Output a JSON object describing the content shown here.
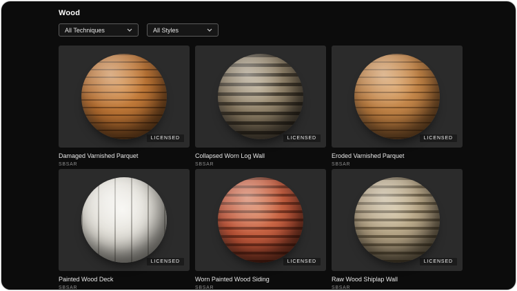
{
  "header": {
    "title": "Wood"
  },
  "filters": {
    "techniques": {
      "label": "All Techniques"
    },
    "styles": {
      "label": "All Styles"
    }
  },
  "cards": [
    {
      "title": "Damaged Varnished Parquet",
      "format": "SBSAR",
      "badge": "LICENSED",
      "sphere": {
        "highlight": "#d28a44",
        "mid": "#b06a2e",
        "shadow": "#5e3a1a",
        "stripe": "rgba(62,32,10,0.55)",
        "stripe_direction": "horizontal",
        "stripe_thickness": 2,
        "stripe_gap": 11
      }
    },
    {
      "title": "Collapsed Worn Log Wall",
      "format": "SBSAR",
      "badge": "LICENSED",
      "sphere": {
        "highlight": "#b5a78d",
        "mid": "#7d6f58",
        "shadow": "#3a332a",
        "stripe": "rgba(28,23,16,0.65)",
        "stripe_direction": "horizontal",
        "stripe_thickness": 5,
        "stripe_gap": 14
      }
    },
    {
      "title": "Eroded Varnished Parquet",
      "format": "SBSAR",
      "badge": "LICENSED",
      "sphere": {
        "highlight": "#d79a5a",
        "mid": "#b5773c",
        "shadow": "#5f3d1e",
        "stripe": "rgba(70,40,14,0.5)",
        "stripe_direction": "horizontal",
        "stripe_thickness": 2,
        "stripe_gap": 11
      }
    },
    {
      "title": "Painted Wood Deck",
      "format": "SBSAR",
      "badge": "LICENSED",
      "sphere": {
        "highlight": "#f6f5f1",
        "mid": "#dcd9d1",
        "shadow": "#8c8a81",
        "stripe": "rgba(95,92,84,0.45)",
        "stripe_direction": "vertical",
        "stripe_thickness": 2,
        "stripe_gap": 24
      }
    },
    {
      "title": "Worn Painted Wood Siding",
      "format": "SBSAR",
      "badge": "LICENSED",
      "sphere": {
        "highlight": "#d97c56",
        "mid": "#bc5236",
        "shadow": "#5a2314",
        "stripe": "rgba(58,18,8,0.55)",
        "stripe_direction": "horizontal",
        "stripe_thickness": 4,
        "stripe_gap": 12
      }
    },
    {
      "title": "Raw Wood Shiplap Wall",
      "format": "SBSAR",
      "badge": "LICENSED",
      "sphere": {
        "highlight": "#cfbf9e",
        "mid": "#a8977a",
        "shadow": "#52462e",
        "stripe": "rgba(52,42,24,0.55)",
        "stripe_direction": "horizontal",
        "stripe_thickness": 4,
        "stripe_gap": 12
      }
    }
  ]
}
